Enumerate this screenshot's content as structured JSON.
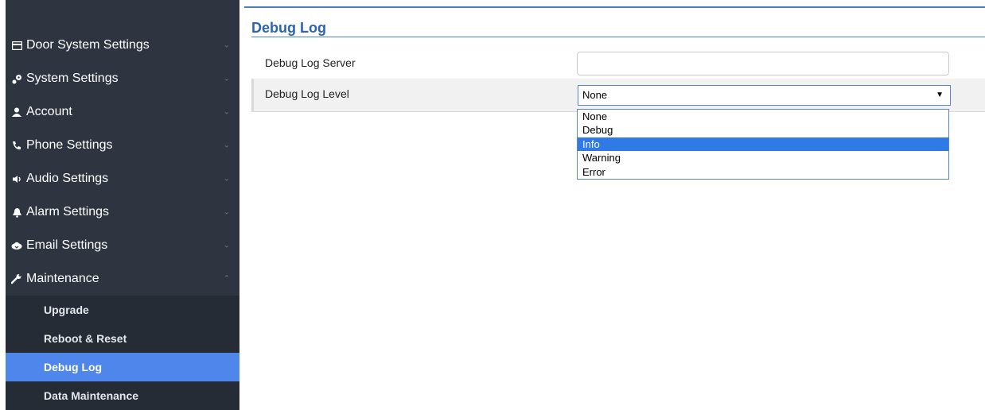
{
  "sidebar": {
    "items": [
      {
        "label": "Door System Settings",
        "icon": "card-icon",
        "chevron": "⌄"
      },
      {
        "label": "System Settings",
        "icon": "wrench-gear-icon",
        "chevron": "⌄"
      },
      {
        "label": "Account",
        "icon": "user-icon",
        "chevron": "⌄"
      },
      {
        "label": "Phone Settings",
        "icon": "phone-icon",
        "chevron": "⌄"
      },
      {
        "label": "Audio Settings",
        "icon": "speaker-icon",
        "chevron": "⌄"
      },
      {
        "label": "Alarm Settings",
        "icon": "bell-icon",
        "chevron": "⌄"
      },
      {
        "label": "Email Settings",
        "icon": "cloud-icon",
        "chevron": "⌄"
      },
      {
        "label": "Maintenance",
        "icon": "wrench-icon",
        "chevron": "⌃"
      }
    ],
    "subitems": [
      {
        "label": "Upgrade"
      },
      {
        "label": "Reboot & Reset"
      },
      {
        "label": "Debug Log",
        "active": true
      },
      {
        "label": "Data Maintenance"
      }
    ]
  },
  "main": {
    "title": "Debug Log",
    "server_label": "Debug Log Server",
    "server_value": "",
    "level_label": "Debug Log Level",
    "level_selected": "None",
    "level_options": [
      "None",
      "Debug",
      "Info",
      "Warning",
      "Error"
    ],
    "level_highlighted": "Info"
  },
  "colors": {
    "sidebar_bg": "#2e3540",
    "active_bg": "#4f86ec",
    "title": "#2b64b0",
    "highlight": "#2f7ae5"
  }
}
